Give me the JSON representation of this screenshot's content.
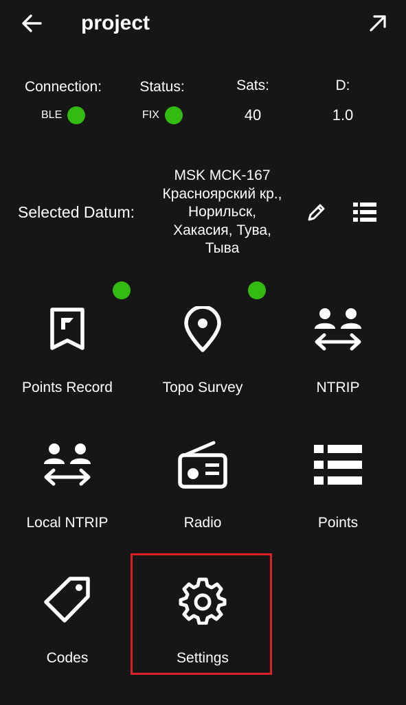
{
  "header": {
    "title": "project"
  },
  "status": {
    "connection_label": "Connection:",
    "connection_value": "BLE",
    "status_label": "Status:",
    "status_value": "FIX",
    "sats_label": "Sats:",
    "sats_value": "40",
    "d_label": "D:",
    "d_value": "1.0",
    "indicator_color": "#33bb11"
  },
  "datum": {
    "label": "Selected Datum:",
    "value": "MSK MCK-167 Красноярский кр., Норильск, Хакасия, Тува, Тыва"
  },
  "tiles": [
    {
      "label": "Points Record",
      "icon": "bookmark-flag-icon",
      "indicator": true
    },
    {
      "label": "Topo Survey",
      "icon": "map-pin-icon",
      "indicator": true
    },
    {
      "label": "NTRIP",
      "icon": "users-transfer-icon",
      "indicator": false
    },
    {
      "label": "Local NTRIP",
      "icon": "users-transfer-icon",
      "indicator": false
    },
    {
      "label": "Radio",
      "icon": "radio-icon",
      "indicator": false
    },
    {
      "label": "Points",
      "icon": "list-icon",
      "indicator": false
    },
    {
      "label": "Codes",
      "icon": "tag-icon",
      "indicator": false
    },
    {
      "label": "Settings",
      "icon": "gear-icon",
      "indicator": false
    }
  ],
  "highlight_color": "#dd1f26"
}
